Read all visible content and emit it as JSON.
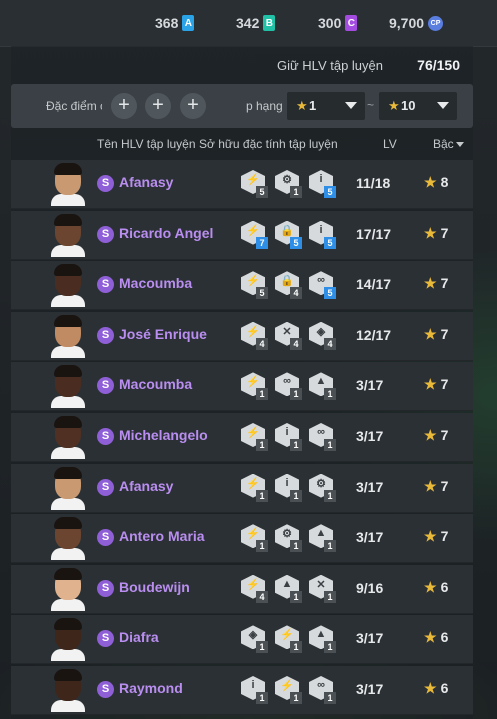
{
  "currencies": [
    {
      "value": "368",
      "token": "A",
      "color": "#2aa3e8"
    },
    {
      "value": "342",
      "token": "B",
      "color": "#21c1a7"
    },
    {
      "value": "300",
      "token": "C",
      "color": "#a44be0"
    },
    {
      "value": "9,700",
      "token": "CP",
      "color": "#5a7de0"
    }
  ],
  "keep": {
    "label": "Giữ HLV tập luyện",
    "value": "76/150"
  },
  "filter": {
    "traits_label": "Đặc điểm c",
    "rank_label": "p hạng",
    "tilde": "~",
    "min": "1",
    "max": "10",
    "star": "★"
  },
  "columns": {
    "name": "Tên HLV tập luyện",
    "traits": "Sở hữu đặc tính tập luyện",
    "lv": "LV",
    "rank": "Bậc"
  },
  "rows": [
    {
      "name": "Afanasy",
      "skin": "#c99a72",
      "traits": [
        {
          "icon": "whistle-icon",
          "g": "⚡",
          "lvl": "5",
          "hl": false
        },
        {
          "icon": "tactics-icon",
          "g": "⚙",
          "lvl": "1",
          "hl": false
        },
        {
          "icon": "info-icon",
          "g": "i",
          "lvl": "5",
          "hl": true
        }
      ],
      "lv": "11/18",
      "rank": "8"
    },
    {
      "name": "Ricardo Angel",
      "skin": "#6b4530",
      "traits": [
        {
          "icon": "whistle-icon",
          "g": "⚡",
          "lvl": "7",
          "hl": true
        },
        {
          "icon": "lock-icon",
          "g": "🔒",
          "lvl": "5",
          "hl": true
        },
        {
          "icon": "info-icon",
          "g": "i",
          "lvl": "5",
          "hl": true
        }
      ],
      "lv": "17/17",
      "rank": "7"
    },
    {
      "name": "Macoumba",
      "skin": "#4a2d20",
      "traits": [
        {
          "icon": "whistle-icon",
          "g": "⚡",
          "lvl": "5",
          "hl": false
        },
        {
          "icon": "lock-icon",
          "g": "🔒",
          "lvl": "4",
          "hl": false
        },
        {
          "icon": "chain-icon",
          "g": "∞",
          "lvl": "5",
          "hl": true
        }
      ],
      "lv": "14/17",
      "rank": "7"
    },
    {
      "name": "José Enrique",
      "skin": "#c08a62",
      "traits": [
        {
          "icon": "whistle-icon",
          "g": "⚡",
          "lvl": "4",
          "hl": false
        },
        {
          "icon": "cross-icon",
          "g": "✕",
          "lvl": "4",
          "hl": false
        },
        {
          "icon": "shield-icon",
          "g": "◈",
          "lvl": "4",
          "hl": false
        }
      ],
      "lv": "12/17",
      "rank": "7"
    },
    {
      "name": "Macoumba",
      "skin": "#4a2d20",
      "traits": [
        {
          "icon": "whistle-icon",
          "g": "⚡",
          "lvl": "1",
          "hl": false
        },
        {
          "icon": "chain-icon",
          "g": "∞",
          "lvl": "1",
          "hl": false
        },
        {
          "icon": "cap-icon",
          "g": "▲",
          "lvl": "1",
          "hl": false
        }
      ],
      "lv": "3/17",
      "rank": "7"
    },
    {
      "name": "Michelangelo",
      "skin": "#4f3023",
      "traits": [
        {
          "icon": "whistle-icon",
          "g": "⚡",
          "lvl": "1",
          "hl": false
        },
        {
          "icon": "info-icon",
          "g": "i",
          "lvl": "1",
          "hl": false
        },
        {
          "icon": "chain-icon",
          "g": "∞",
          "lvl": "1",
          "hl": false
        }
      ],
      "lv": "3/17",
      "rank": "7"
    },
    {
      "name": "Afanasy",
      "skin": "#c99a72",
      "traits": [
        {
          "icon": "whistle-icon",
          "g": "⚡",
          "lvl": "1",
          "hl": false
        },
        {
          "icon": "info-icon",
          "g": "i",
          "lvl": "1",
          "hl": false
        },
        {
          "icon": "tactics-icon",
          "g": "⚙",
          "lvl": "1",
          "hl": false
        }
      ],
      "lv": "3/17",
      "rank": "7"
    },
    {
      "name": "Antero Maria",
      "skin": "#6b4530",
      "traits": [
        {
          "icon": "whistle-icon",
          "g": "⚡",
          "lvl": "1",
          "hl": false
        },
        {
          "icon": "tactics-icon",
          "g": "⚙",
          "lvl": "1",
          "hl": false
        },
        {
          "icon": "cap-icon",
          "g": "▲",
          "lvl": "1",
          "hl": false
        }
      ],
      "lv": "3/17",
      "rank": "7"
    },
    {
      "name": "Boudewijn",
      "skin": "#e0b28e",
      "traits": [
        {
          "icon": "whistle-icon",
          "g": "⚡",
          "lvl": "4",
          "hl": false
        },
        {
          "icon": "cap-icon",
          "g": "▲",
          "lvl": "1",
          "hl": false
        },
        {
          "icon": "cross-icon",
          "g": "✕",
          "lvl": "1",
          "hl": false
        }
      ],
      "lv": "9/16",
      "rank": "6"
    },
    {
      "name": "Diafra",
      "skin": "#3e261b",
      "traits": [
        {
          "icon": "shield-icon",
          "g": "◈",
          "lvl": "1",
          "hl": false
        },
        {
          "icon": "whistle-icon",
          "g": "⚡",
          "lvl": "1",
          "hl": false
        },
        {
          "icon": "cap-icon",
          "g": "▲",
          "lvl": "1",
          "hl": false
        }
      ],
      "lv": "3/17",
      "rank": "6"
    },
    {
      "name": "Raymond",
      "skin": "#3e261b",
      "traits": [
        {
          "icon": "info-icon",
          "g": "i",
          "lvl": "1",
          "hl": false
        },
        {
          "icon": "whistle-icon",
          "g": "⚡",
          "lvl": "1",
          "hl": false
        },
        {
          "icon": "chain-icon",
          "g": "∞",
          "lvl": "1",
          "hl": false
        }
      ],
      "lv": "3/17",
      "rank": "6"
    }
  ]
}
